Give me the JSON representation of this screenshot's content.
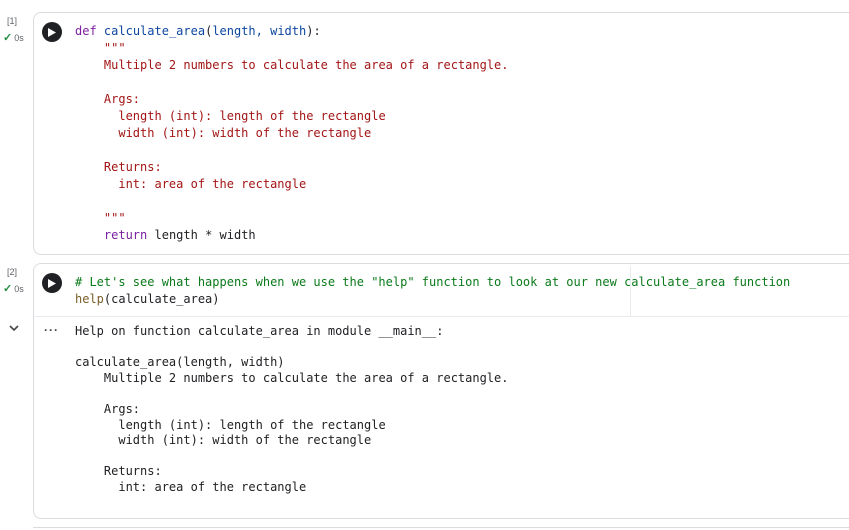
{
  "cell1": {
    "exec_count": "[1]",
    "exec_time": "0s",
    "code": {
      "def_kw": "def",
      "fn_name": "calculate_area",
      "open_paren": "(",
      "params": "length, width",
      "close_sig": "):",
      "doc_open": "\"\"\"",
      "doc_summary": "Multiple 2 numbers to calculate the area of a rectangle.",
      "args_header": "Args:",
      "arg1": "length (int): length of the rectangle",
      "arg2": "width (int): width of the rectangle",
      "returns_header": "Returns:",
      "returns_desc": "int: area of the rectangle",
      "doc_close": "\"\"\"",
      "return_kw": "return",
      "return_expr": "length * width"
    }
  },
  "cell2": {
    "exec_count": "[2]",
    "exec_time": "0s",
    "code": {
      "comment": "# Let's see what happens when we use the \"help\" function to look at our new calculate_area function",
      "help_fn": "help",
      "open_paren": "(",
      "help_arg": "calculate_area",
      "close_paren": ")"
    },
    "output": {
      "header": "Help on function calculate_area in module __main__:",
      "signature": "calculate_area(length, width)",
      "summary": "Multiple 2 numbers to calculate the area of a rectangle.",
      "args_header": "Args:",
      "arg1": "length (int): length of the rectangle",
      "arg2": "width (int): width of the rectangle",
      "returns_header": "Returns:",
      "returns_desc": "int: area of the rectangle"
    }
  },
  "colors": {
    "success": "#1e8e3e",
    "keyword": "#7b1fa2",
    "string": "#a31515",
    "comment": "#0a7a1a",
    "function": "#795e26"
  },
  "icons": {
    "run": "run-cell-icon",
    "check": "checkmark-icon",
    "collapse": "chevron-down-icon",
    "more": "more-horizontal-icon"
  }
}
